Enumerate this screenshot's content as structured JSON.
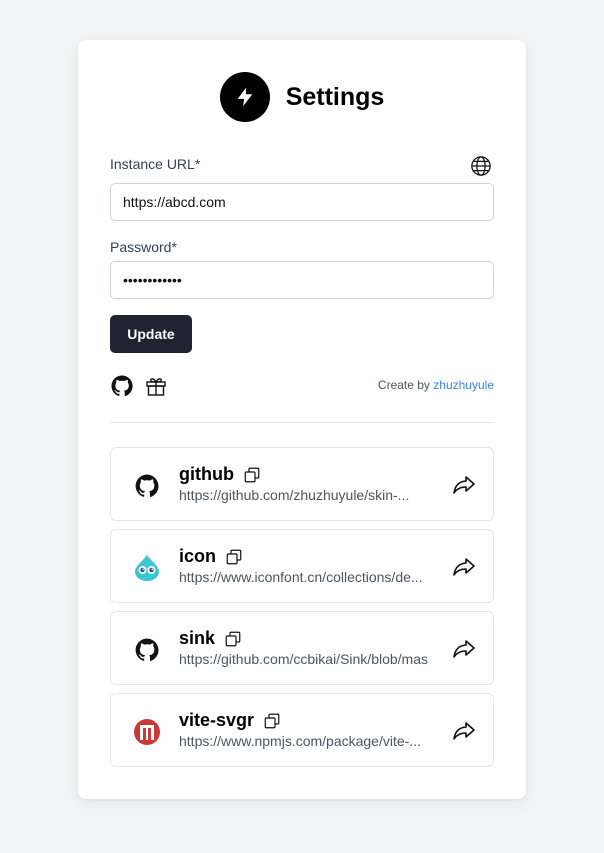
{
  "header": {
    "title": "Settings"
  },
  "form": {
    "instance_label": "Instance URL*",
    "instance_value": "https://abcd.com",
    "password_label": "Password*",
    "password_value": "••••••••••••",
    "update_label": "Update"
  },
  "footer": {
    "credit_prefix": "Create by",
    "credit_author": "zhuzhuyule"
  },
  "links": [
    {
      "name": "github",
      "url": "https://github.com/zhuzhuyule/skin-...",
      "icon": "github-icon"
    },
    {
      "name": "icon",
      "url": "https://www.iconfont.cn/collections/de...",
      "icon": "iconfont-icon"
    },
    {
      "name": "sink",
      "url": "https://github.com/ccbikai/Sink/blob/mas",
      "icon": "github-icon"
    },
    {
      "name": "vite-svgr",
      "url": "https://www.npmjs.com/package/vite-...",
      "icon": "npm-icon"
    }
  ],
  "colors": {
    "accent_link": "#3b82f6",
    "button_bg": "#1f2433",
    "npm_red": "#cb3837",
    "iconfont_teal": "#3bc6d3"
  }
}
